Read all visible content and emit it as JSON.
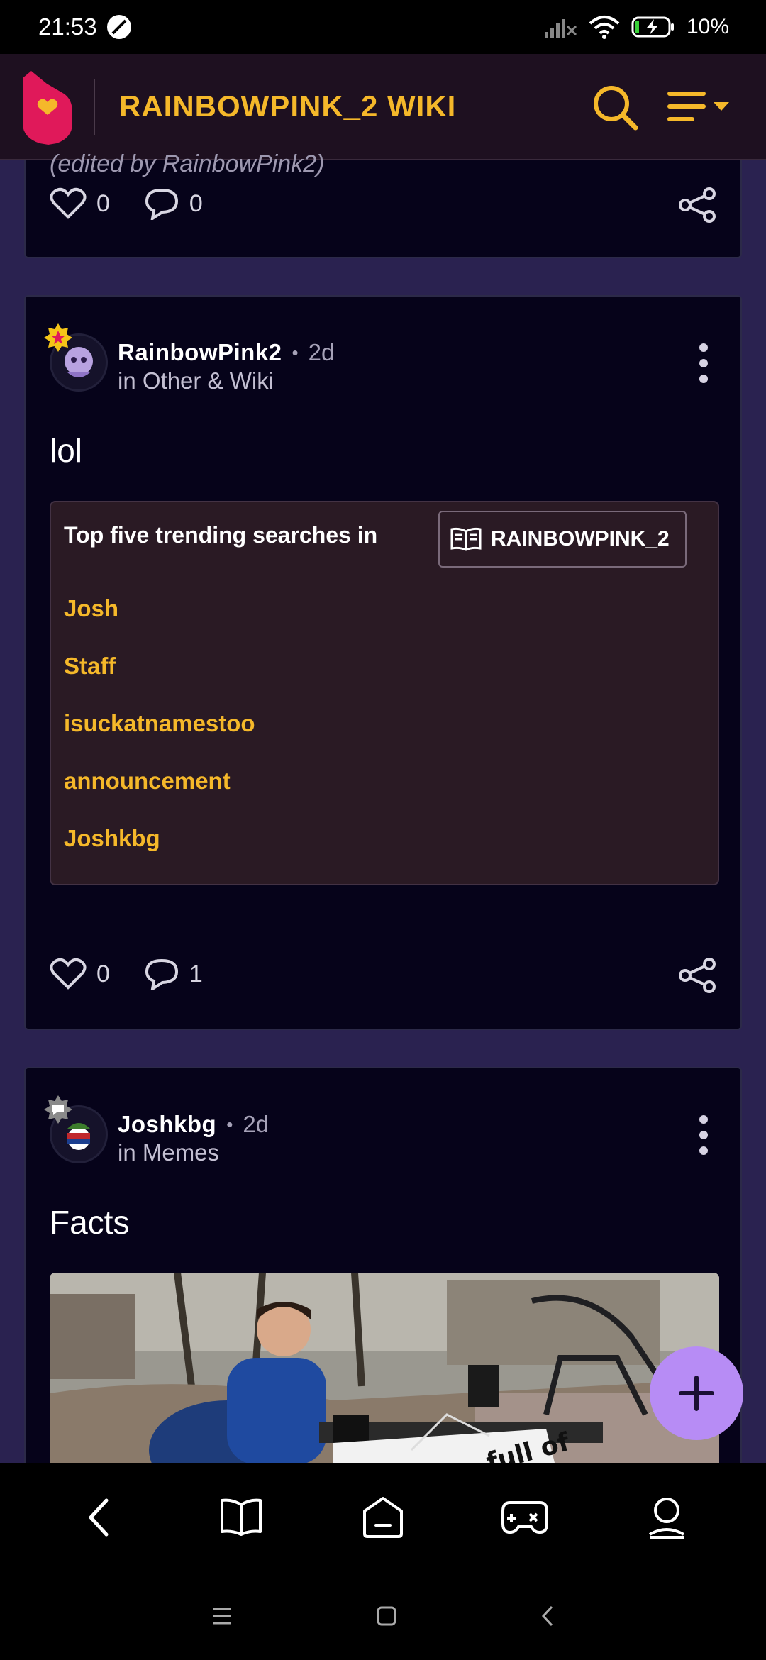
{
  "status_bar": {
    "time": "21:53",
    "battery": "10%"
  },
  "header": {
    "title": "RAINBOWPINK_2 WIKI"
  },
  "prev_post": {
    "cut_text": "(edited by RainbowPink2)",
    "likes": "0",
    "comments": "0"
  },
  "post1": {
    "author": "RainbowPink2",
    "age": "2d",
    "category": "in Other & Wiki",
    "title": "lol",
    "trending": {
      "heading": "Top five trending searches in",
      "wiki_chip": "RAINBOWPINK_2",
      "items": [
        "Josh",
        "Staff",
        "isuckatnamestoo",
        "announcement",
        "Joshkbg"
      ]
    },
    "likes": "0",
    "comments": "1"
  },
  "post2": {
    "author": "Joshkbg",
    "age": "2d",
    "category": "in Memes",
    "title": "Facts",
    "image_sign_text": "full of"
  },
  "colors": {
    "accent": "#f5b82a",
    "fab": "#b78cf5",
    "logo": "#e0195a"
  },
  "icons": {
    "header": [
      "fandom-logo-icon",
      "search-icon",
      "menu-icon"
    ],
    "bottom_nav": [
      "back-icon",
      "book-icon",
      "home-icon",
      "games-icon",
      "profile-icon"
    ],
    "system_nav": [
      "recents-icon",
      "home-square-icon",
      "back-triangle-icon"
    ]
  }
}
